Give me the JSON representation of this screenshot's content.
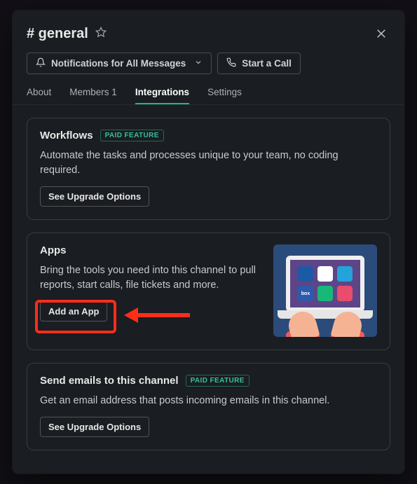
{
  "channel": {
    "hash_name": "# general"
  },
  "toolbar": {
    "notifications_label": "Notifications for All Messages",
    "start_call_label": "Start a Call"
  },
  "tabs": {
    "about": "About",
    "members": "Members 1",
    "integrations": "Integrations",
    "settings": "Settings",
    "active": "integrations"
  },
  "cards": {
    "workflows": {
      "title": "Workflows",
      "badge": "PAID FEATURE",
      "desc": "Automate the tasks and processes unique to your team, no coding required.",
      "cta": "See Upgrade Options"
    },
    "apps": {
      "title": "Apps",
      "desc": "Bring the tools you need into this channel to pull reports, start calls, file tickets and more.",
      "cta": "Add an App"
    },
    "emails": {
      "title": "Send emails to this channel",
      "badge": "PAID FEATURE",
      "desc": "Get an email address that posts incoming emails in this channel.",
      "cta": "See Upgrade Options"
    }
  },
  "illustration": {
    "apps_box_label": "box"
  }
}
